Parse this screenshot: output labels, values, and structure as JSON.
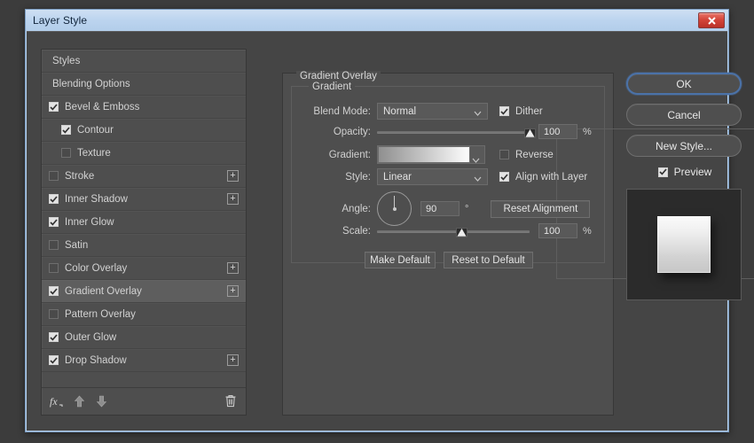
{
  "window": {
    "title": "Layer Style",
    "close_label": "Close"
  },
  "styles_panel": {
    "items": [
      {
        "label": "Styles",
        "kind": "header",
        "checkbox": null,
        "indent": false,
        "plus": false,
        "selected": false
      },
      {
        "label": "Blending Options",
        "kind": "header",
        "checkbox": null,
        "indent": false,
        "plus": false,
        "selected": false
      },
      {
        "label": "Bevel & Emboss",
        "kind": "effect",
        "checkbox": "checked",
        "indent": false,
        "plus": false,
        "selected": false
      },
      {
        "label": "Contour",
        "kind": "effect",
        "checkbox": "checked",
        "indent": true,
        "plus": false,
        "selected": false
      },
      {
        "label": "Texture",
        "kind": "effect",
        "checkbox": "unchecked",
        "indent": true,
        "plus": false,
        "selected": false
      },
      {
        "label": "Stroke",
        "kind": "effect",
        "checkbox": "unchecked",
        "indent": false,
        "plus": true,
        "selected": false
      },
      {
        "label": "Inner Shadow",
        "kind": "effect",
        "checkbox": "checked",
        "indent": false,
        "plus": true,
        "selected": false
      },
      {
        "label": "Inner Glow",
        "kind": "effect",
        "checkbox": "checked",
        "indent": false,
        "plus": false,
        "selected": false
      },
      {
        "label": "Satin",
        "kind": "effect",
        "checkbox": "unchecked",
        "indent": false,
        "plus": false,
        "selected": false
      },
      {
        "label": "Color Overlay",
        "kind": "effect",
        "checkbox": "unchecked",
        "indent": false,
        "plus": true,
        "selected": false
      },
      {
        "label": "Gradient Overlay",
        "kind": "effect",
        "checkbox": "checked",
        "indent": false,
        "plus": true,
        "selected": true
      },
      {
        "label": "Pattern Overlay",
        "kind": "effect",
        "checkbox": "unchecked",
        "indent": false,
        "plus": false,
        "selected": false
      },
      {
        "label": "Outer Glow",
        "kind": "effect",
        "checkbox": "checked",
        "indent": false,
        "plus": false,
        "selected": false
      },
      {
        "label": "Drop Shadow",
        "kind": "effect",
        "checkbox": "checked",
        "indent": false,
        "plus": true,
        "selected": false
      }
    ],
    "toolbar": {
      "fx_label": "fx",
      "move_up_label": "Move Up",
      "move_down_label": "Move Down",
      "delete_label": "Delete Effect"
    }
  },
  "main": {
    "section_title": "Gradient Overlay",
    "group_title": "Gradient",
    "blend_mode": {
      "label": "Blend Mode:",
      "value": "Normal"
    },
    "dither": {
      "label": "Dither",
      "checked": true
    },
    "opacity": {
      "label": "Opacity:",
      "value": "100",
      "unit": "%",
      "percent": 100
    },
    "gradient": {
      "label": "Gradient:",
      "from_color": "#8f8f8f",
      "to_color": "#fdfdfd"
    },
    "reverse": {
      "label": "Reverse",
      "checked": false
    },
    "style": {
      "label": "Style:",
      "value": "Linear"
    },
    "align_with_layer": {
      "label": "Align with Layer",
      "checked": true
    },
    "angle": {
      "label": "Angle:",
      "value": "90",
      "unit": "°"
    },
    "reset_alignment": {
      "label": "Reset Alignment"
    },
    "scale": {
      "label": "Scale:",
      "value": "100",
      "unit": "%",
      "percent": 55
    },
    "make_default": {
      "label": "Make Default"
    },
    "reset_to_default": {
      "label": "Reset to Default"
    }
  },
  "actions": {
    "ok": "OK",
    "cancel": "Cancel",
    "new_style": "New Style...",
    "preview": {
      "label": "Preview",
      "checked": true
    }
  }
}
